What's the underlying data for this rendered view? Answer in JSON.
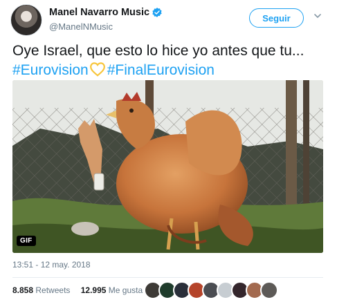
{
  "author": {
    "name": "Manel Navarro Music",
    "handle": "@ManelNMusic",
    "avatar_icon": "profile-photo",
    "verified_icon": "verified-badge-icon",
    "verified_color": "#1da1f2"
  },
  "follow_button": {
    "label": "Seguir"
  },
  "menu_icon": "chevron-down-icon",
  "tweet": {
    "text": "Oye Israel, que esto lo hice yo antes que tu...",
    "hashtag_1": "#Eurovision",
    "emoji_icon": "yellow-heart-icon",
    "hashtag_2": "#FinalEurovision"
  },
  "media": {
    "badge": "GIF",
    "content": "gif-chicken-dance"
  },
  "timestamp": "13:51 - 12 may. 2018",
  "stats": {
    "retweets_count": "8.858",
    "retweets_label": "Retweets",
    "likes_count": "12.995",
    "likes_label": "Me gusta"
  },
  "likers": [
    {
      "color": "#3d3a36"
    },
    {
      "color": "#1f3c2c"
    },
    {
      "color": "#2a2f3a"
    },
    {
      "color": "#b5442a"
    },
    {
      "color": "#4b4d52"
    },
    {
      "color": "#c7cdd2"
    },
    {
      "color": "#34262c"
    },
    {
      "color": "#a36a4f"
    },
    {
      "color": "#5d5a57"
    }
  ],
  "colors": {
    "accent": "#1da1f2",
    "text": "#14171a",
    "muted": "#657786",
    "border": "#e6ecf0"
  }
}
